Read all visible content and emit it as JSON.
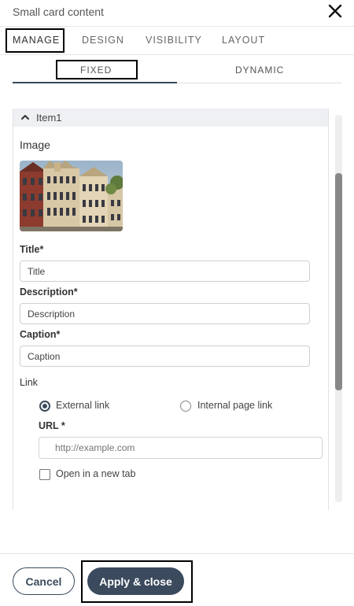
{
  "dialog": {
    "title": "Small card content",
    "close_icon": "close-icon"
  },
  "tabs": [
    {
      "label": "MANAGE",
      "active": true
    },
    {
      "label": "DESIGN",
      "active": false
    },
    {
      "label": "VISIBILITY",
      "active": false
    },
    {
      "label": "LAYOUT",
      "active": false
    }
  ],
  "subtabs": [
    {
      "label": "FIXED",
      "active": true
    },
    {
      "label": "DYNAMIC",
      "active": false
    }
  ],
  "item": {
    "label": "Item1",
    "expanded": true,
    "chevron_icon": "chevron-up-icon",
    "image_label": "Image",
    "fields": {
      "title": {
        "label": "Title*",
        "value": "Title"
      },
      "description": {
        "label": "Description*",
        "value": "Description"
      },
      "caption": {
        "label": "Caption*",
        "value": "Caption"
      }
    },
    "link": {
      "label": "Link",
      "options": [
        {
          "label": "External link",
          "selected": true
        },
        {
          "label": "Internal page link",
          "selected": false
        }
      ],
      "url_label": "URL *",
      "url_value": "",
      "url_placeholder": "http://example.com",
      "new_tab_label": "Open in a new tab",
      "new_tab_checked": false
    }
  },
  "footer": {
    "cancel_label": "Cancel",
    "apply_label": "Apply & close"
  },
  "colors": {
    "primary": "#3b4a5d",
    "border": "#cfcfcf",
    "item_header_bg": "#eef0f3"
  }
}
